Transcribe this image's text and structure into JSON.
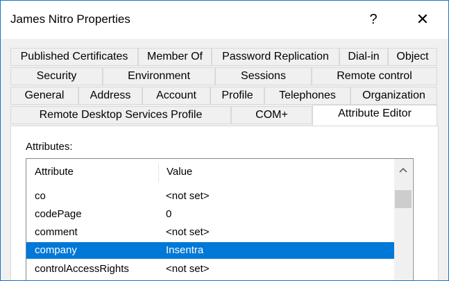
{
  "window": {
    "title": "James Nitro Properties",
    "help_label": "?",
    "close_label": "✕"
  },
  "tabs": {
    "row1": [
      "Published Certificates",
      "Member Of",
      "Password Replication",
      "Dial-in",
      "Object"
    ],
    "row2": [
      "Security",
      "Environment",
      "Sessions",
      "Remote control"
    ],
    "row3": [
      "General",
      "Address",
      "Account",
      "Profile",
      "Telephones",
      "Organization"
    ],
    "row4": [
      "Remote Desktop Services Profile",
      "COM+",
      "Attribute Editor"
    ],
    "active": "Attribute Editor"
  },
  "attributes": {
    "label": "Attributes:",
    "columns": [
      "Attribute",
      "Value"
    ],
    "rows": [
      {
        "attribute": "co",
        "value": "<not set>"
      },
      {
        "attribute": "codePage",
        "value": "0"
      },
      {
        "attribute": "comment",
        "value": "<not set>"
      },
      {
        "attribute": "company",
        "value": "Insentra",
        "selected": true
      },
      {
        "attribute": "controlAccessRights",
        "value": "<not set>"
      }
    ],
    "scroll_up_icon": "chevron-up-icon",
    "selection_color": "#0078d7"
  }
}
